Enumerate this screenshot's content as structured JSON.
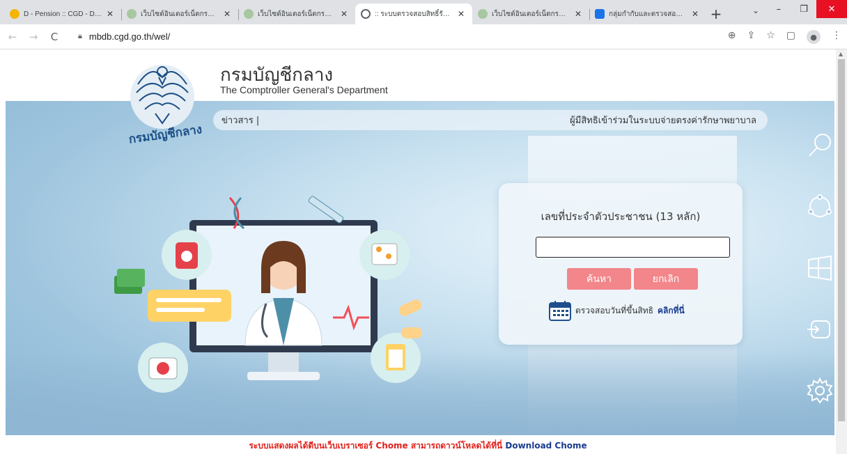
{
  "tabs": [
    {
      "title": "D - Pension :: CGD - D - Pe",
      "favicon_color": "#f4b400",
      "active": false
    },
    {
      "title": "เว็บไซต์อินเตอร์เน็ตกรมบัญชีกลาง",
      "favicon_color": "#a8c7a0",
      "active": false
    },
    {
      "title": "เว็บไซต์อินเตอร์เน็ตกรมบัญชีกลาง",
      "favicon_color": "#a8c7a0",
      "active": false
    },
    {
      "title": ":: ระบบตรวจสอบสิทธิ์รักษาพยาบาล",
      "favicon_color": "#5f6368",
      "active": true
    },
    {
      "title": "เว็บไซต์อินเตอร์เน็ตกรมบัญชีกลาง",
      "favicon_color": "#a8c7a0",
      "active": false
    },
    {
      "title": "กลุ่มกำกับและตรวจสอบระบบบำ",
      "favicon_color": "#1a73e8",
      "active": false
    }
  ],
  "browser": {
    "url": "mbdb.cgd.go.th/wel/",
    "new_tab": "+",
    "tab_search": "⌄",
    "min": "–",
    "max": "❐",
    "close": "✕"
  },
  "site": {
    "name_th": "กรมบัญชีกลาง",
    "name_en": "The Comptroller General's Department",
    "logo_text": "กรมบัญชีกลาง",
    "nav_news": "ข่าวสาร |",
    "nav_right": "ผู้มีสิทธิเข้าร่วมในระบบจ่ายตรงค่ารักษาพยาบาล"
  },
  "search_card": {
    "label": "เลขที่ประจำตัวประชาชน (13 หลัก)",
    "input_value": "",
    "search_button": "ค้นหา",
    "cancel_button": "ยกเลิก",
    "check_text": "ตรวจสอบวันที่ขึ้นสิทธิ",
    "check_link": "คลิกที่นี่"
  },
  "footer": {
    "note": "ระบบแสดงผลได้ดีบนเว็บเบราเซอร์ Chome สามารถดาวน์โหลดได้ที่นี่",
    "link": "Download Chome"
  },
  "colors": {
    "button": "#f2868a",
    "footer_note": "#e0201b",
    "link": "#1a3b8f"
  },
  "side_icons": [
    "search-icon",
    "network-icon",
    "windows-icon",
    "signout-icon",
    "gear-icon"
  ]
}
